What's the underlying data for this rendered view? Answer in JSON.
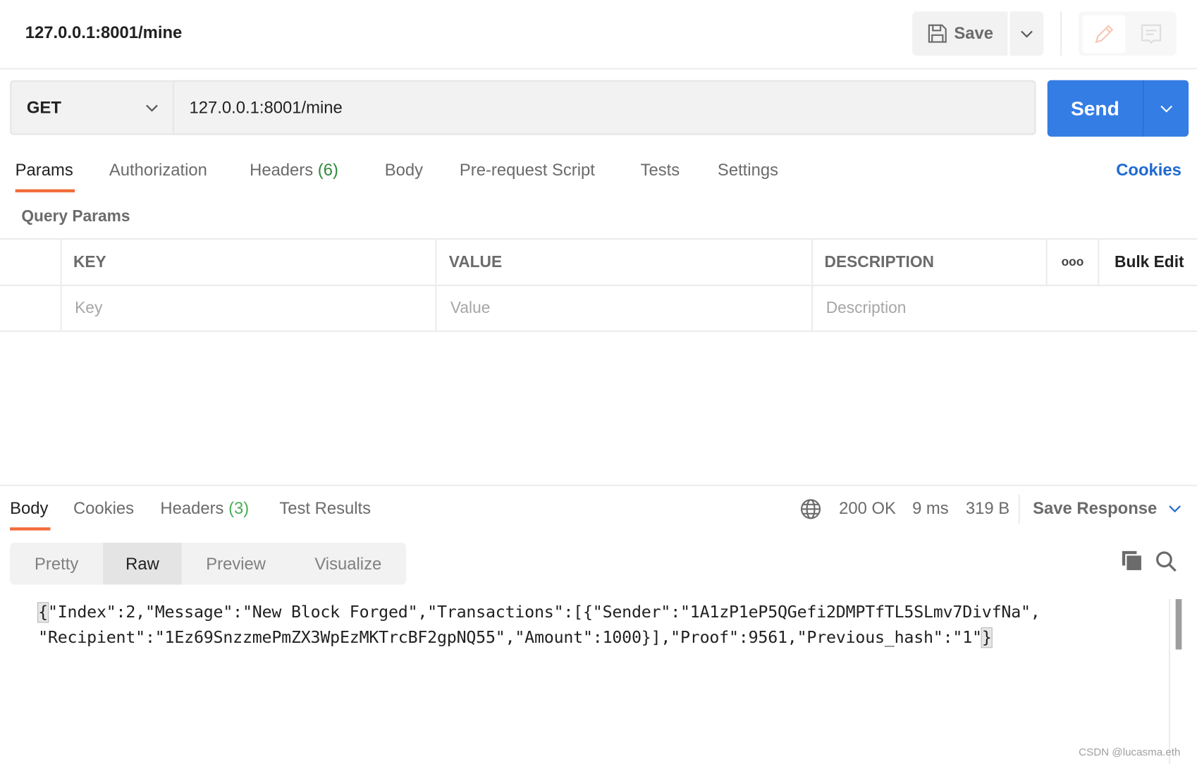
{
  "header": {
    "title": "127.0.0.1:8001/mine",
    "save_label": "Save",
    "icons": [
      "save-icon",
      "chevron-down-icon",
      "pencil-icon",
      "comment-icon"
    ]
  },
  "request": {
    "method": "GET",
    "url": "127.0.0.1:8001/mine",
    "send_label": "Send"
  },
  "tabs": [
    {
      "label": "Params"
    },
    {
      "label": "Authorization"
    },
    {
      "label": "Headers",
      "count": "(6)"
    },
    {
      "label": "Body"
    },
    {
      "label": "Pre-request Script"
    },
    {
      "label": "Tests"
    },
    {
      "label": "Settings"
    }
  ],
  "cookies_label": "Cookies",
  "query_params": {
    "title": "Query Params",
    "columns": [
      "KEY",
      "VALUE",
      "DESCRIPTION"
    ],
    "more": "ooo",
    "bulk_edit": "Bulk Edit",
    "placeholders": [
      "Key",
      "Value",
      "Description"
    ]
  },
  "response": {
    "tabs": [
      {
        "label": "Body"
      },
      {
        "label": "Cookies"
      },
      {
        "label": "Headers",
        "count": "(3)"
      },
      {
        "label": "Test Results"
      }
    ],
    "status": "200 OK",
    "time": "9 ms",
    "size": "319 B",
    "save_response": "Save Response",
    "views": [
      "Pretty",
      "Raw",
      "Preview",
      "Visualize"
    ],
    "active_view": "Raw",
    "body_open": "{",
    "body_line1": "\"Index\":2,\"Message\":\"New Block Forged\",\"Transactions\":[{\"Sender\":\"1A1zP1eP5QGefi2DMPTfTL5SLmv7DivfNa\",",
    "body_line2": "\"Recipient\":\"1Ez69SnzzmePmZX3WpEzMKTrcBF2gpNQ55\",\"Amount\":1000}],\"Proof\":9561,\"Previous_hash\":\"1\"",
    "body_close": "}"
  },
  "watermark": "CSDN @lucasma.eth",
  "colors": {
    "accent": "#347de4",
    "status_green": "#2f8a3a",
    "tab_underline": "#f26b3a",
    "link": "#1f6ad0"
  }
}
